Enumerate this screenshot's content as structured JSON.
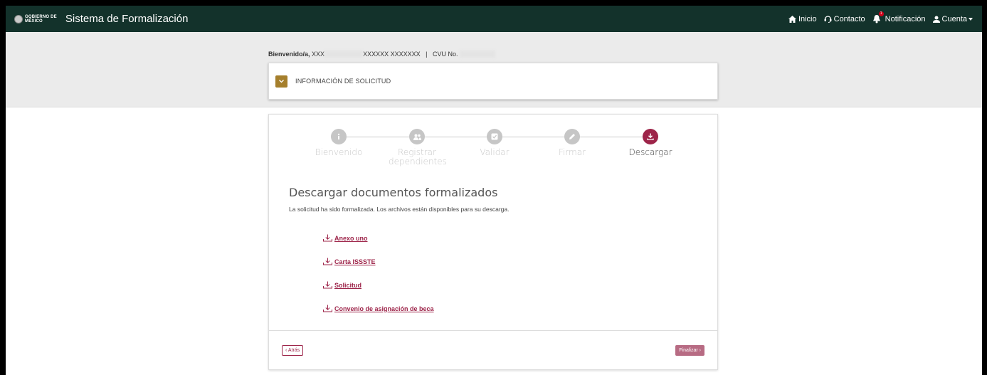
{
  "navbar": {
    "logo_line1": "GOBIERNO DE",
    "logo_line2": "MÉXICO",
    "title": "Sistema de Formalización",
    "links": {
      "inicio": "Inicio",
      "contacto": "Contacto",
      "notificacion": "Notificación",
      "notification_count": "1",
      "cuenta": "Cuenta"
    }
  },
  "welcome": {
    "label": "Bienvenido/a,",
    "name_visible_start": "XXX",
    "name_visible_end": "XXXXXX XXXXXXX",
    "separator": "|",
    "cvu_label": "CVU No."
  },
  "info_panel": {
    "title": "INFORMACIÓN DE SOLICITUD"
  },
  "stepper": {
    "steps": [
      {
        "label": "Bienvenido",
        "icon": "info-icon"
      },
      {
        "label": "Registrar dependientes",
        "icon": "users-icon"
      },
      {
        "label": "Validar",
        "icon": "check-square-icon"
      },
      {
        "label": "Firmar",
        "icon": "pencil-icon"
      },
      {
        "label": "Descargar",
        "icon": "download-icon",
        "active": true
      }
    ]
  },
  "content": {
    "title": "Descargar documentos formalizados",
    "description": "La solicitud ha sido formalizada. Los archivos están disponibles para su descarga.",
    "documents": [
      "Anexo uno",
      "Carta ISSSTE",
      "Solicitud",
      "Convenio de asignación de beca"
    ]
  },
  "footer": {
    "back_label": "Atrás",
    "finish_label": "Finalizar"
  },
  "colors": {
    "navbar": "#13322b",
    "accent": "#9d2449",
    "gold": "#a57f2c"
  }
}
